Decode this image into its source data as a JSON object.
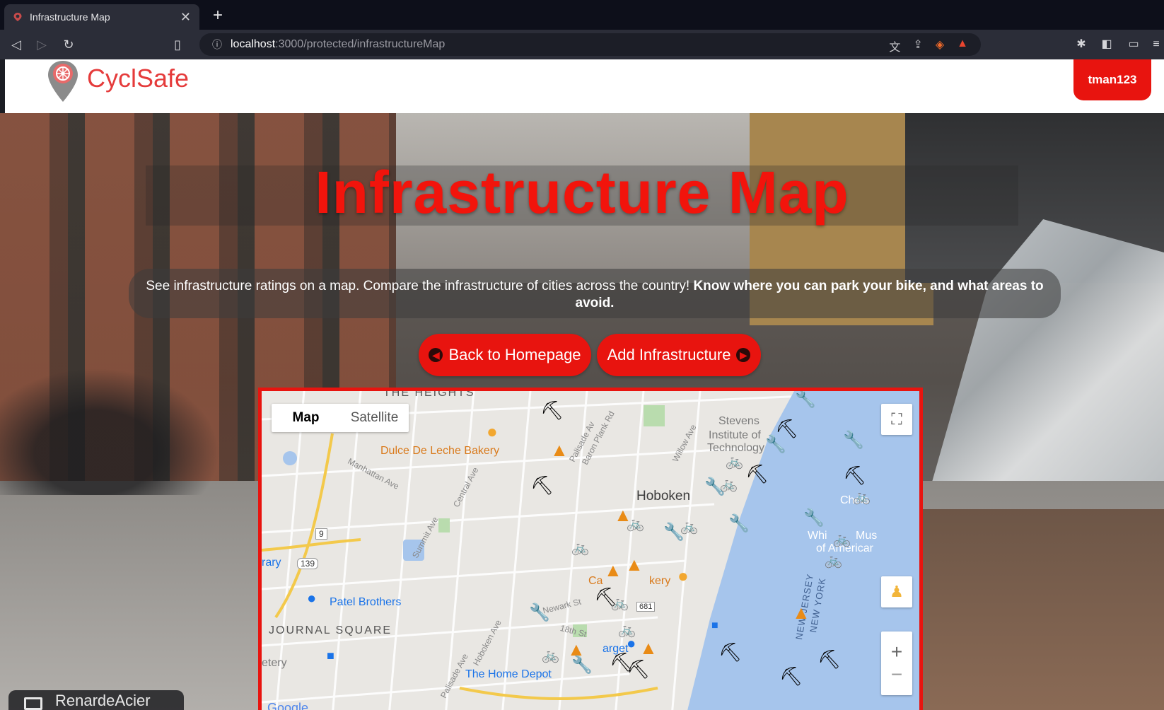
{
  "browser": {
    "tab_title": "Infrastructure Map",
    "tab_close": "✕",
    "new_tab": "+",
    "url_host": "localhost",
    "url_path": ":3000/protected/infrastructureMap"
  },
  "header": {
    "logo_text": "CyclSafe",
    "user_label": "tman123"
  },
  "hero": {
    "title": "Infrastructure Map",
    "description_plain": "See infrastructure ratings on a map. Compare the infrastructure of cities across the country! ",
    "description_bold": "Know where you can park your bike, and what areas to avoid."
  },
  "buttons": {
    "back_label": "Back to Homepage",
    "add_label": "Add Infrastructure"
  },
  "map": {
    "type_options": [
      "Map",
      "Satellite"
    ],
    "active_type": "Map",
    "labels": {
      "heights": "THE HEIGHTS",
      "dulce": "Dulce De Leche Bakery",
      "manhattan_ave": "Manhattan Ave",
      "central_ave": "Central Ave",
      "summit_ave": "Summit Ave",
      "palisade": "Palisade Av",
      "baron": "Baron Plank Rd",
      "willow": "Willow Ave",
      "stevens_1": "Stevens",
      "stevens_2": "Institute of",
      "stevens_3": "Technology",
      "hoboken": "Hoboken",
      "rary": "rary",
      "route_139": "139",
      "route_9": "9",
      "patel": "Patel Brothers",
      "journal": "JOURNAL SQUARE",
      "cemetery": "etery",
      "bakery": "kery",
      "carlo": "Ca",
      "newark": "Newark St",
      "st18": "18th St",
      "route_681": "681",
      "hoboken_ave": "Hoboken Ave",
      "target": "arget",
      "home_depot": "The Home Depot",
      "chelsea": "Chels",
      "whitney_1": "Whi",
      "whitney_2": "Mus",
      "american": "of Americar",
      "nj": "NEW JERSEY",
      "ny": "NEW YORK",
      "google": "Google",
      "palisade_ave": "Palisade Ave"
    }
  },
  "watermark": {
    "text": "RenardeAcier"
  }
}
